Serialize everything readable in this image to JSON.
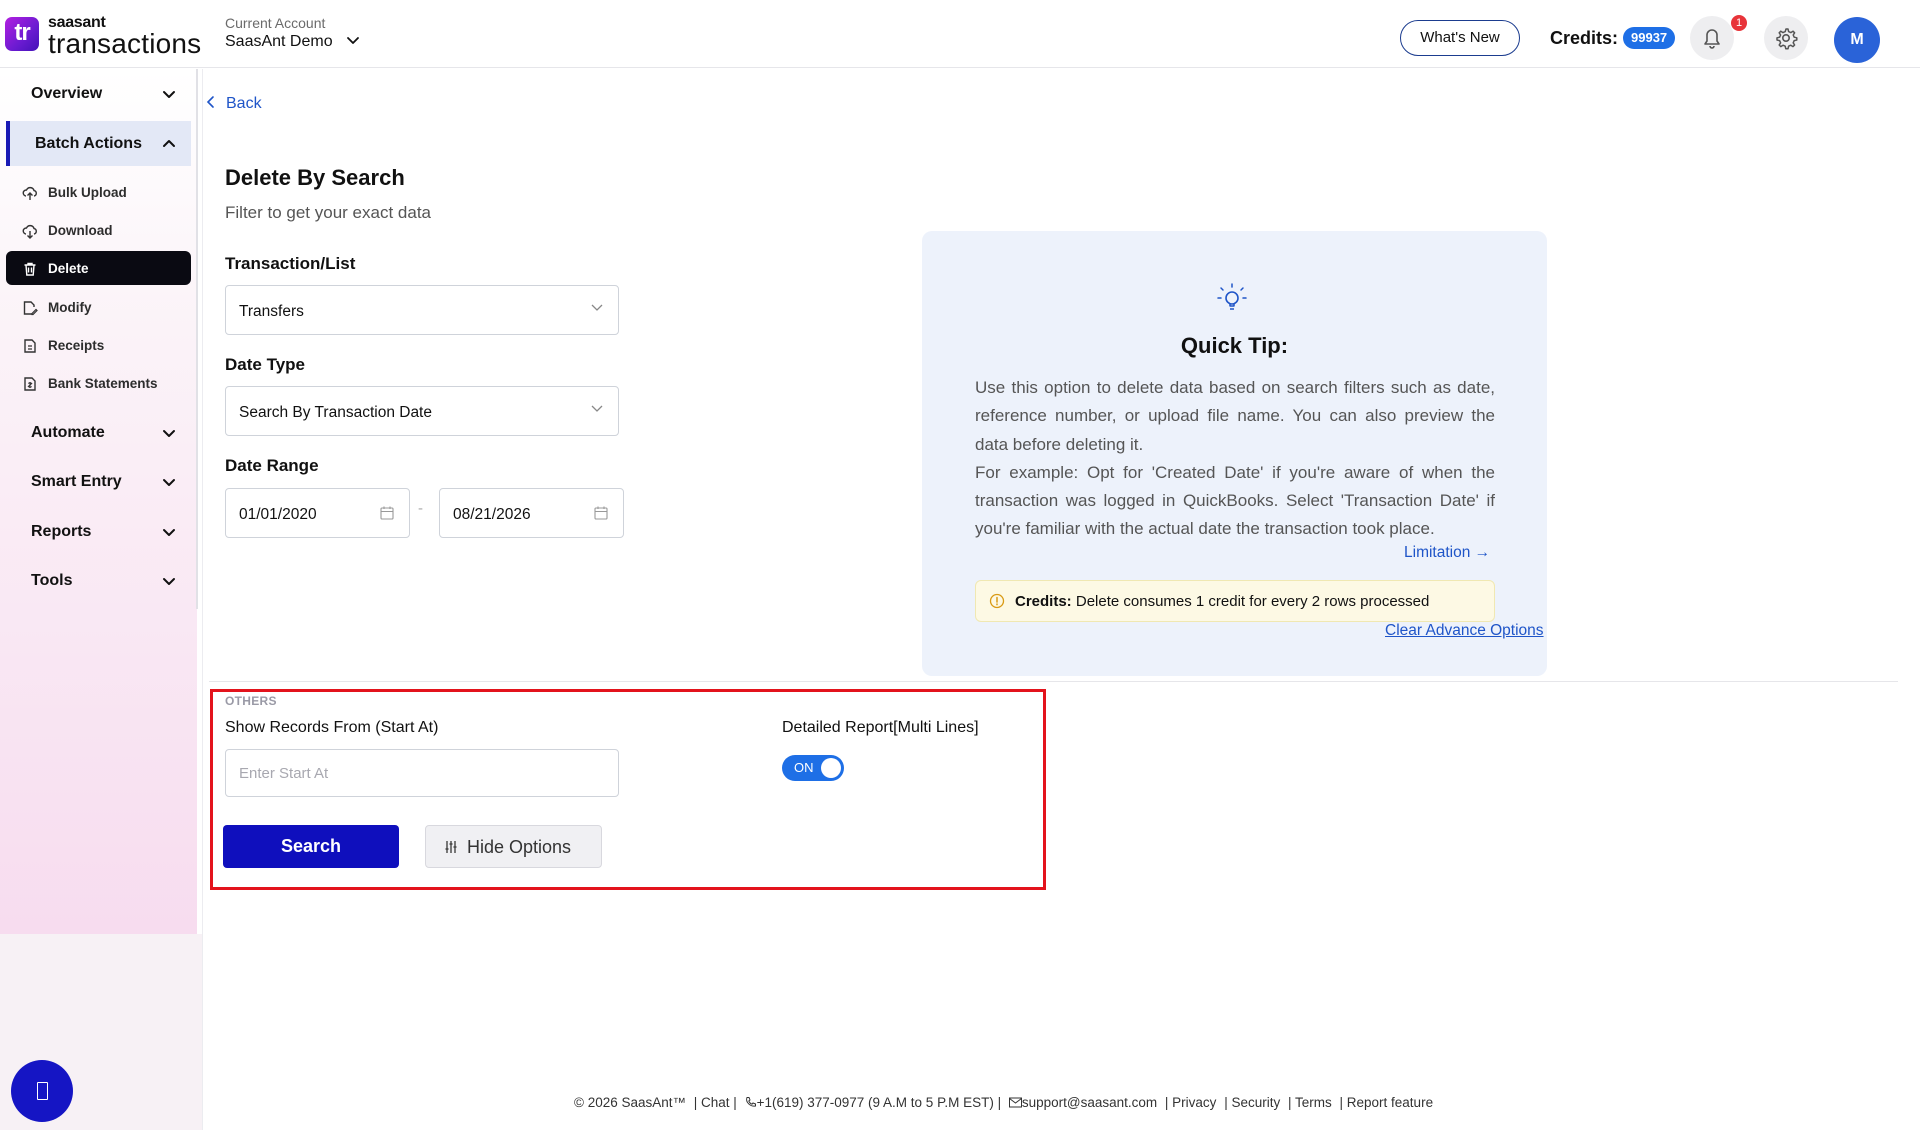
{
  "header": {
    "logo_mark": "tr",
    "logo_small": "saasant",
    "logo_big": "transactions",
    "account_label": "Current Account",
    "account_name": "SaasAnt Demo",
    "whats_new": "What's New",
    "credits_label": "Credits:",
    "credits_value": "99937",
    "notification_count": "1",
    "avatar_initial": "M"
  },
  "sidebar": {
    "groups": [
      {
        "label": "Overview"
      },
      {
        "label": "Batch Actions"
      },
      {
        "label": "Automate"
      },
      {
        "label": "Smart Entry"
      },
      {
        "label": "Reports"
      },
      {
        "label": "Tools"
      }
    ],
    "batch_items": [
      {
        "label": "Bulk Upload",
        "icon": "cloud-upload-icon"
      },
      {
        "label": "Download",
        "icon": "cloud-download-icon"
      },
      {
        "label": "Delete",
        "icon": "trash-icon",
        "active": true
      },
      {
        "label": "Modify",
        "icon": "edit-file-icon"
      },
      {
        "label": "Receipts",
        "icon": "receipt-icon"
      },
      {
        "label": "Bank Statements",
        "icon": "bank-statement-icon"
      }
    ]
  },
  "main": {
    "back": "Back",
    "title": "Delete By Search",
    "subtitle": "Filter to get your exact data",
    "transaction_label": "Transaction/List",
    "transaction_value": "Transfers",
    "date_type_label": "Date Type",
    "date_type_value": "Search By Transaction Date",
    "date_range_label": "Date Range",
    "date_from": "01/01/2020",
    "date_sep": "-",
    "date_to": "08/21/2026"
  },
  "tip": {
    "title": "Quick Tip:",
    "body_1": "Use this option to delete data based on search filters such as date, reference number, or upload file name. You can also preview the data before deleting it.",
    "body_2": "For example: Opt for 'Created Date' if you're aware of when the transaction was logged in QuickBooks. Select 'Transaction Date' if you're familiar with the actual date the transaction took place.",
    "limitation": "Limitation →",
    "credits_bold": "Credits:",
    "credits_text": " Delete consumes 1 credit for every 2 rows processed",
    "clear_advance": "Clear Advance Options"
  },
  "others": {
    "section_label": "OTHERS",
    "start_label": "Show Records From (Start At)",
    "start_placeholder": "Enter Start At",
    "start_value": "",
    "detailed_label": "Detailed Report[Multi Lines]",
    "toggle_text": "ON",
    "search_button": "Search",
    "hide_button": "Hide Options"
  },
  "footer": {
    "copyright": "© 2026 SaasAnt™",
    "chat": "| Chat  |",
    "phone": "+1(619) 377-0977 (9 A.M to 5 P.M EST)  |",
    "email": "support@saasant.com",
    "privacy": "| Privacy",
    "security": "| Security",
    "terms": "| Terms",
    "report": "| Report feature"
  },
  "colors": {
    "brand_primary": "#0f0fbd",
    "link": "#1f55c8",
    "active_nav": "#0a0a12",
    "highlight": "#e3131c",
    "tip_bg": "#edf2fb"
  }
}
